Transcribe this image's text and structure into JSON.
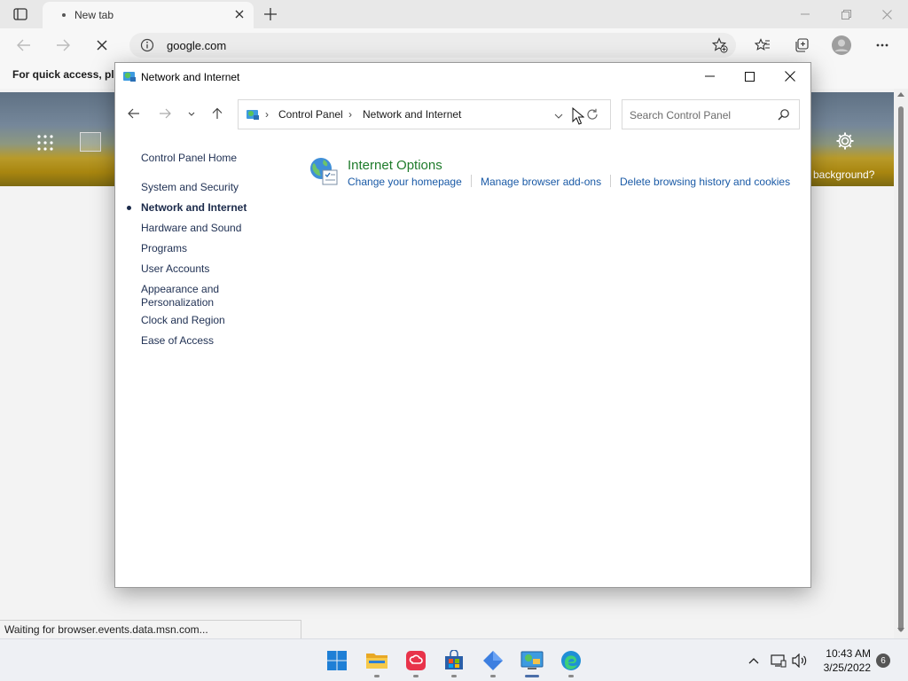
{
  "browser": {
    "tab": {
      "title": "New tab"
    },
    "address": {
      "url": "google.com"
    },
    "favorites_bar": {
      "text": "For quick access, plac"
    },
    "newtab": {
      "background_text": "background?"
    },
    "status": {
      "text": "Waiting for browser.events.data.msn.com..."
    }
  },
  "control_panel": {
    "window_title": "Network and Internet",
    "breadcrumb": [
      "Control Panel",
      "Network and Internet"
    ],
    "search_placeholder": "Search Control Panel",
    "sidebar": {
      "home": "Control Panel Home",
      "items": [
        {
          "label": "System and Security",
          "active": false
        },
        {
          "label": "Network and Internet",
          "active": true
        },
        {
          "label": "Hardware and Sound",
          "active": false
        },
        {
          "label": "Programs",
          "active": false
        },
        {
          "label": "User Accounts",
          "active": false
        },
        {
          "label": "Appearance and",
          "label2": "Personalization",
          "active": false
        },
        {
          "label": "Clock and Region",
          "active": false
        },
        {
          "label": "Ease of Access",
          "active": false
        }
      ]
    },
    "category": {
      "title": "Internet Options",
      "tasks": [
        "Change your homepage",
        "Manage browser add-ons",
        "Delete browsing history and cookies"
      ]
    }
  },
  "taskbar": {
    "apps": [
      "start-icon",
      "file-explorer-icon",
      "creative-cloud-icon",
      "store-icon",
      "app-blue-diamond-icon",
      "control-panel-icon",
      "edge-icon"
    ],
    "clock": {
      "time": "10:43 AM",
      "date": "3/25/2022"
    },
    "notifications": "6"
  },
  "colors": {
    "link": "#1a5aa6",
    "category_title": "#1e7b2b",
    "taskbar_accent": "#4a6ea9"
  }
}
